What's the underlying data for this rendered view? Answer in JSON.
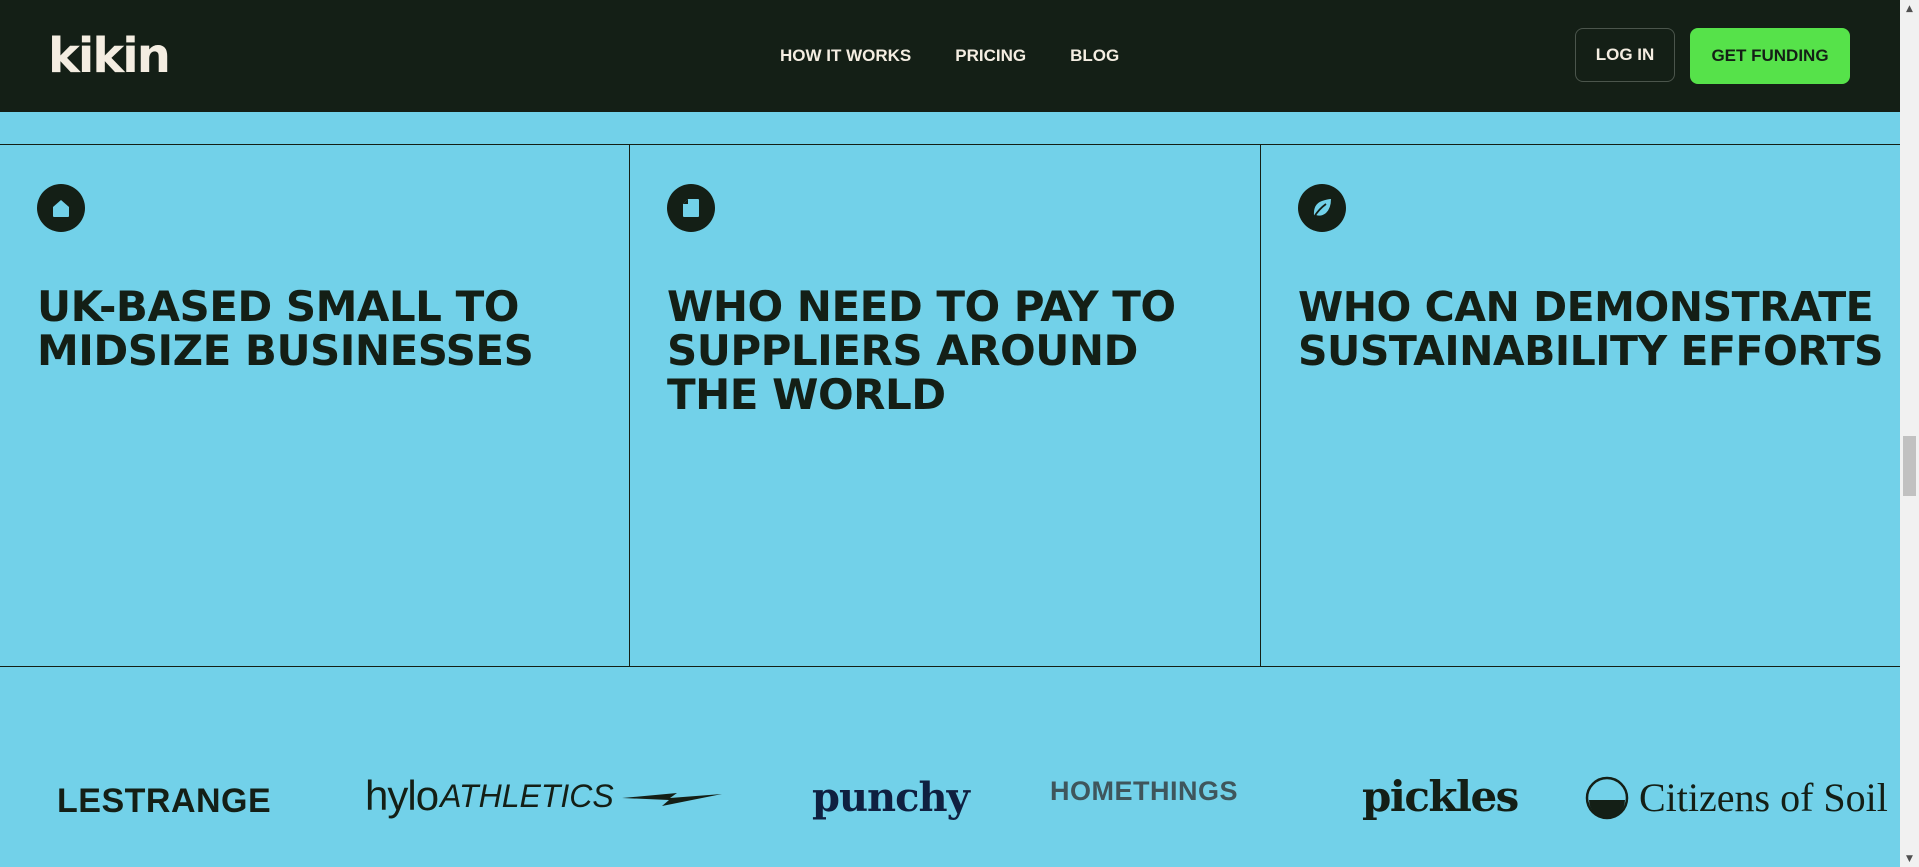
{
  "nav": {
    "logo": "kikin",
    "links": [
      "HOW IT WORKS",
      "PRICING",
      "BLOG"
    ],
    "login_label": "LOG IN",
    "cta_label": "GET FUNDING",
    "cta_color": "#56e24a",
    "bg_color": "#141f16"
  },
  "features": [
    {
      "icon": "home-icon",
      "heading": "UK-BASED SMALL TO MIDSIZE BUSINESSES"
    },
    {
      "icon": "document-icon",
      "heading": "WHO NEED TO PAY TO SUPPLIERS AROUND THE WORLD"
    },
    {
      "icon": "leaf-icon",
      "heading": "WHO CAN DEMONSTRATE SUSTAINABILITY EFFORTS"
    }
  ],
  "section_bg_color": "#72d1e9",
  "brands": {
    "lestrange": "LESTRANGE",
    "hylo_a": "hylo",
    "hylo_b": "ATHLETICS",
    "punchy": "punchy",
    "homethings": "HOMETHINGS",
    "pickles": "pickles",
    "citizens": "Citizens of Soil"
  }
}
